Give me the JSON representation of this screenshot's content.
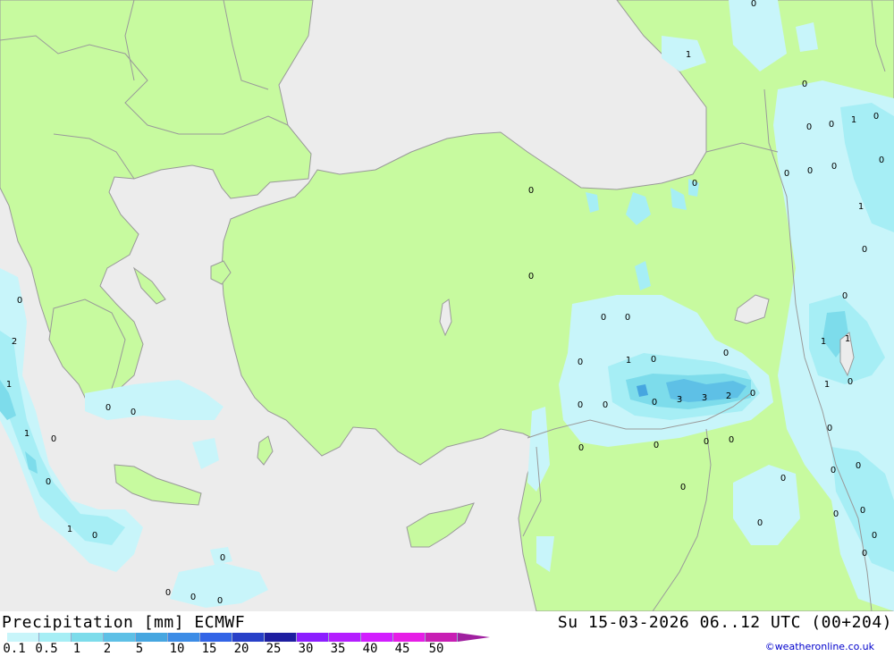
{
  "header": {
    "title": "Precipitation [mm] ECMWF",
    "valid_time": "Su 15-03-2026 06..12 UTC (00+204)"
  },
  "colors": {
    "sea": "#ececec",
    "land": "#c7fa9f",
    "border": "#999999",
    "p_0_1": "#c8f5fa",
    "p_0_5": "#a6eef5",
    "p_1": "#7ddceb",
    "p_2": "#5ec0e6",
    "p_3": "#46a6e0"
  },
  "legend": {
    "ticks": [
      "0.1",
      "0.5",
      "1",
      "2",
      "5",
      "10",
      "15",
      "20",
      "25",
      "30",
      "35",
      "40",
      "45",
      "50"
    ],
    "colors": [
      "#c8f5fa",
      "#a6eef5",
      "#7ddceb",
      "#5ec0e6",
      "#46a6e0",
      "#3c8ce6",
      "#3264e6",
      "#2840c8",
      "#1e1ea0",
      "#8c1eff",
      "#b41eff",
      "#d21eff",
      "#e61ee6",
      "#c81eb4"
    ]
  },
  "precip_labels": [
    "0",
    "1",
    "0",
    "0",
    "1",
    "0",
    "0",
    "0",
    "0",
    "0",
    "0",
    "0",
    "0",
    "1",
    "0",
    "0",
    "0",
    "0",
    "0",
    "0",
    "2",
    "1",
    "1",
    "0",
    "0",
    "0",
    "1",
    "1",
    "1",
    "0",
    "0",
    "0",
    "0",
    "0",
    "0",
    "0",
    "1",
    "0",
    "0",
    "0",
    "0",
    "0",
    "0",
    "3",
    "3",
    "2",
    "0",
    "0",
    "0",
    "0",
    "0",
    "0",
    "0",
    "1",
    "0",
    "0",
    "0",
    "0",
    "0",
    "0",
    "0",
    "0",
    "0",
    "0",
    "0",
    "0",
    "0",
    "0"
  ],
  "credit": "©weatheronline.co.uk"
}
